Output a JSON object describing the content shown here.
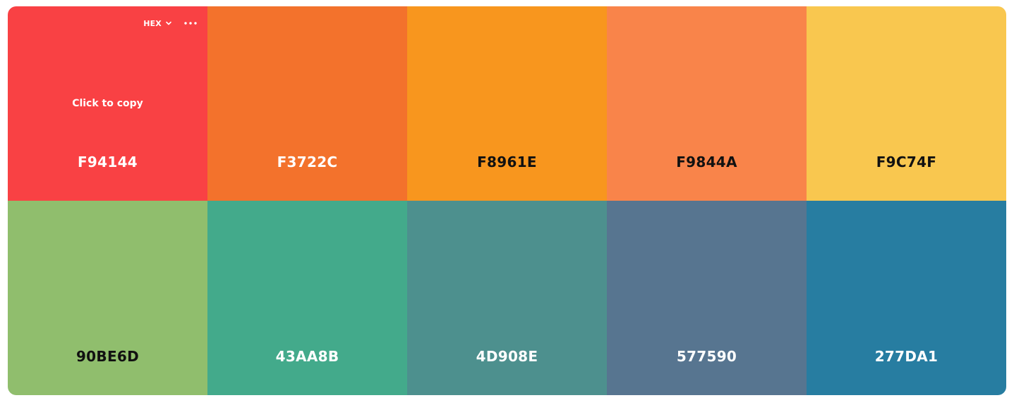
{
  "toolbar": {
    "format_label": "HEX",
    "chevron_icon": "chevron-down-icon",
    "more_icon": "more-horizontal-icon"
  },
  "hint": {
    "copy_text": "Click to copy"
  },
  "swatches": [
    {
      "hex": "F94144",
      "color": "#F94144",
      "text_color": "light"
    },
    {
      "hex": "F3722C",
      "color": "#F3722C",
      "text_color": "light"
    },
    {
      "hex": "F8961E",
      "color": "#F8961E",
      "text_color": "dark"
    },
    {
      "hex": "F9844A",
      "color": "#F9844A",
      "text_color": "dark"
    },
    {
      "hex": "F9C74F",
      "color": "#F9C74F",
      "text_color": "dark"
    },
    {
      "hex": "90BE6D",
      "color": "#90BE6D",
      "text_color": "dark"
    },
    {
      "hex": "43AA8B",
      "color": "#43AA8B",
      "text_color": "light"
    },
    {
      "hex": "4D908E",
      "color": "#4D908E",
      "text_color": "light"
    },
    {
      "hex": "577590",
      "color": "#577590",
      "text_color": "light"
    },
    {
      "hex": "277DA1",
      "color": "#277DA1",
      "text_color": "light"
    }
  ]
}
